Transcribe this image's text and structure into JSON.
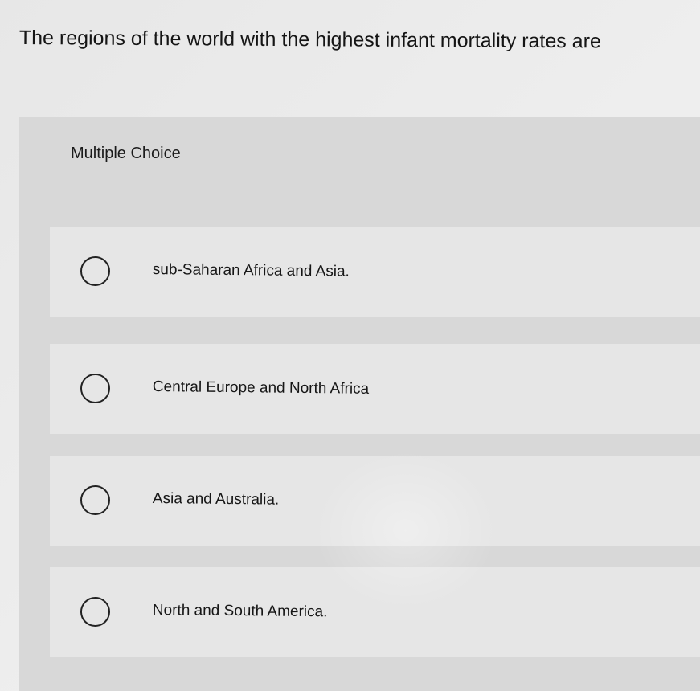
{
  "question": {
    "text": "The regions of the world with the highest infant mortality rates are"
  },
  "panel": {
    "type_label": "Multiple Choice"
  },
  "choices": [
    {
      "label": "sub-Saharan Africa and Asia."
    },
    {
      "label": "Central Europe and North Africa"
    },
    {
      "label": "Asia and Australia."
    },
    {
      "label": "North and South America."
    }
  ],
  "icons": {
    "radio": "radio-button-icon"
  }
}
